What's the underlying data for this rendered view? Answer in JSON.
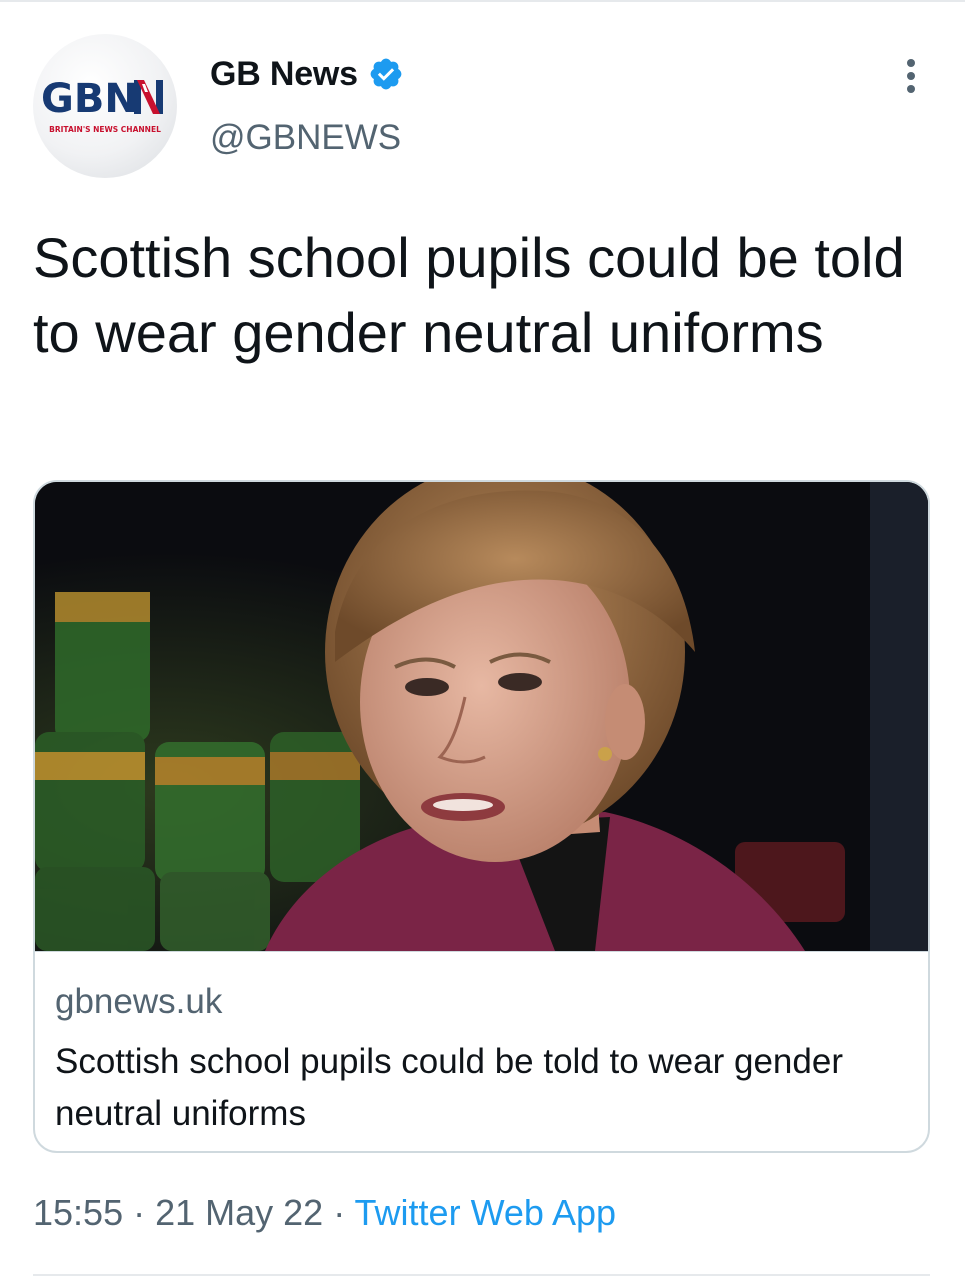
{
  "tweet": {
    "author": {
      "display_name": "GB News",
      "handle": "@GBNEWS",
      "verified": true,
      "avatar": {
        "logo_text": "GBN",
        "tagline": "BRITAIN'S NEWS CHANNEL"
      }
    },
    "text": "Scottish school pupils could be told to wear gender neutral uniforms",
    "card": {
      "domain": "gbnews.uk",
      "title": "Scottish school pupils could be told to wear gender neutral uniforms"
    },
    "meta": {
      "time": "15:55",
      "separator": " · ",
      "date": "21 May 22",
      "source": "Twitter Web App"
    }
  },
  "icons": {
    "verified": "verified-badge-icon",
    "more": "more-vertical-icon"
  },
  "colors": {
    "brand_blue": "#1d9bf0",
    "logo_navy": "#173a73",
    "logo_red": "#c8102e",
    "secondary_text": "#536471"
  }
}
